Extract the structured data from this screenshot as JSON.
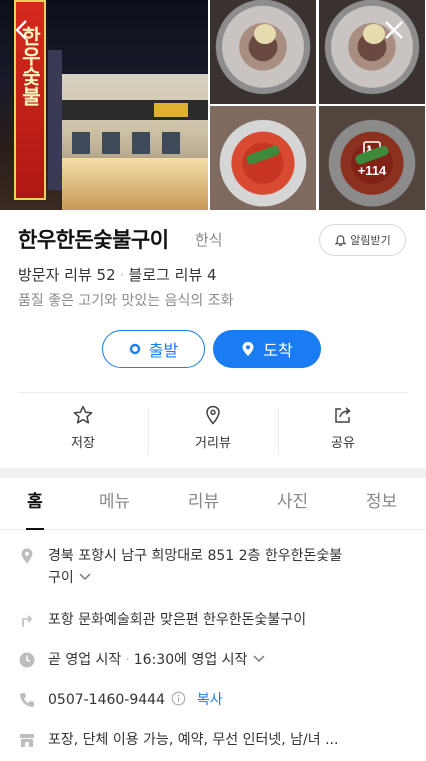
{
  "place": {
    "name": "한우한돈숯불구이",
    "category": "한식",
    "alarm_label": "알림받기",
    "visitor_reviews": "방문자 리뷰 52",
    "blog_reviews": "블로그 리뷰 4",
    "description": "품질 좋은 고기와 맛있는 음식의 조화"
  },
  "photos": {
    "more_count": "+114"
  },
  "route": {
    "depart": "출발",
    "arrive": "도착"
  },
  "actions": [
    {
      "label": "저장",
      "icon": "star-icon"
    },
    {
      "label": "거리뷰",
      "icon": "location-pin-icon"
    },
    {
      "label": "공유",
      "icon": "share-icon"
    }
  ],
  "tabs": [
    "홈",
    "메뉴",
    "리뷰",
    "사진",
    "정보"
  ],
  "info": {
    "address_line1": "경북 포항시 남구 희망대로 851 2층 한우한돈숯불",
    "address_line2": "구이",
    "directions": "포항 문화예술회관 맞은편 한우한돈숯불구이",
    "hours_status": "곧 영업 시작",
    "hours_detail": "16:30에 영업 시작",
    "phone": "0507-1460-9444",
    "copy_label": "복사",
    "amenities": "포장, 단체 이용 가능, 예약, 무선 인터넷, 남/녀 ..."
  },
  "colors": {
    "accent": "#1a7cf2"
  }
}
